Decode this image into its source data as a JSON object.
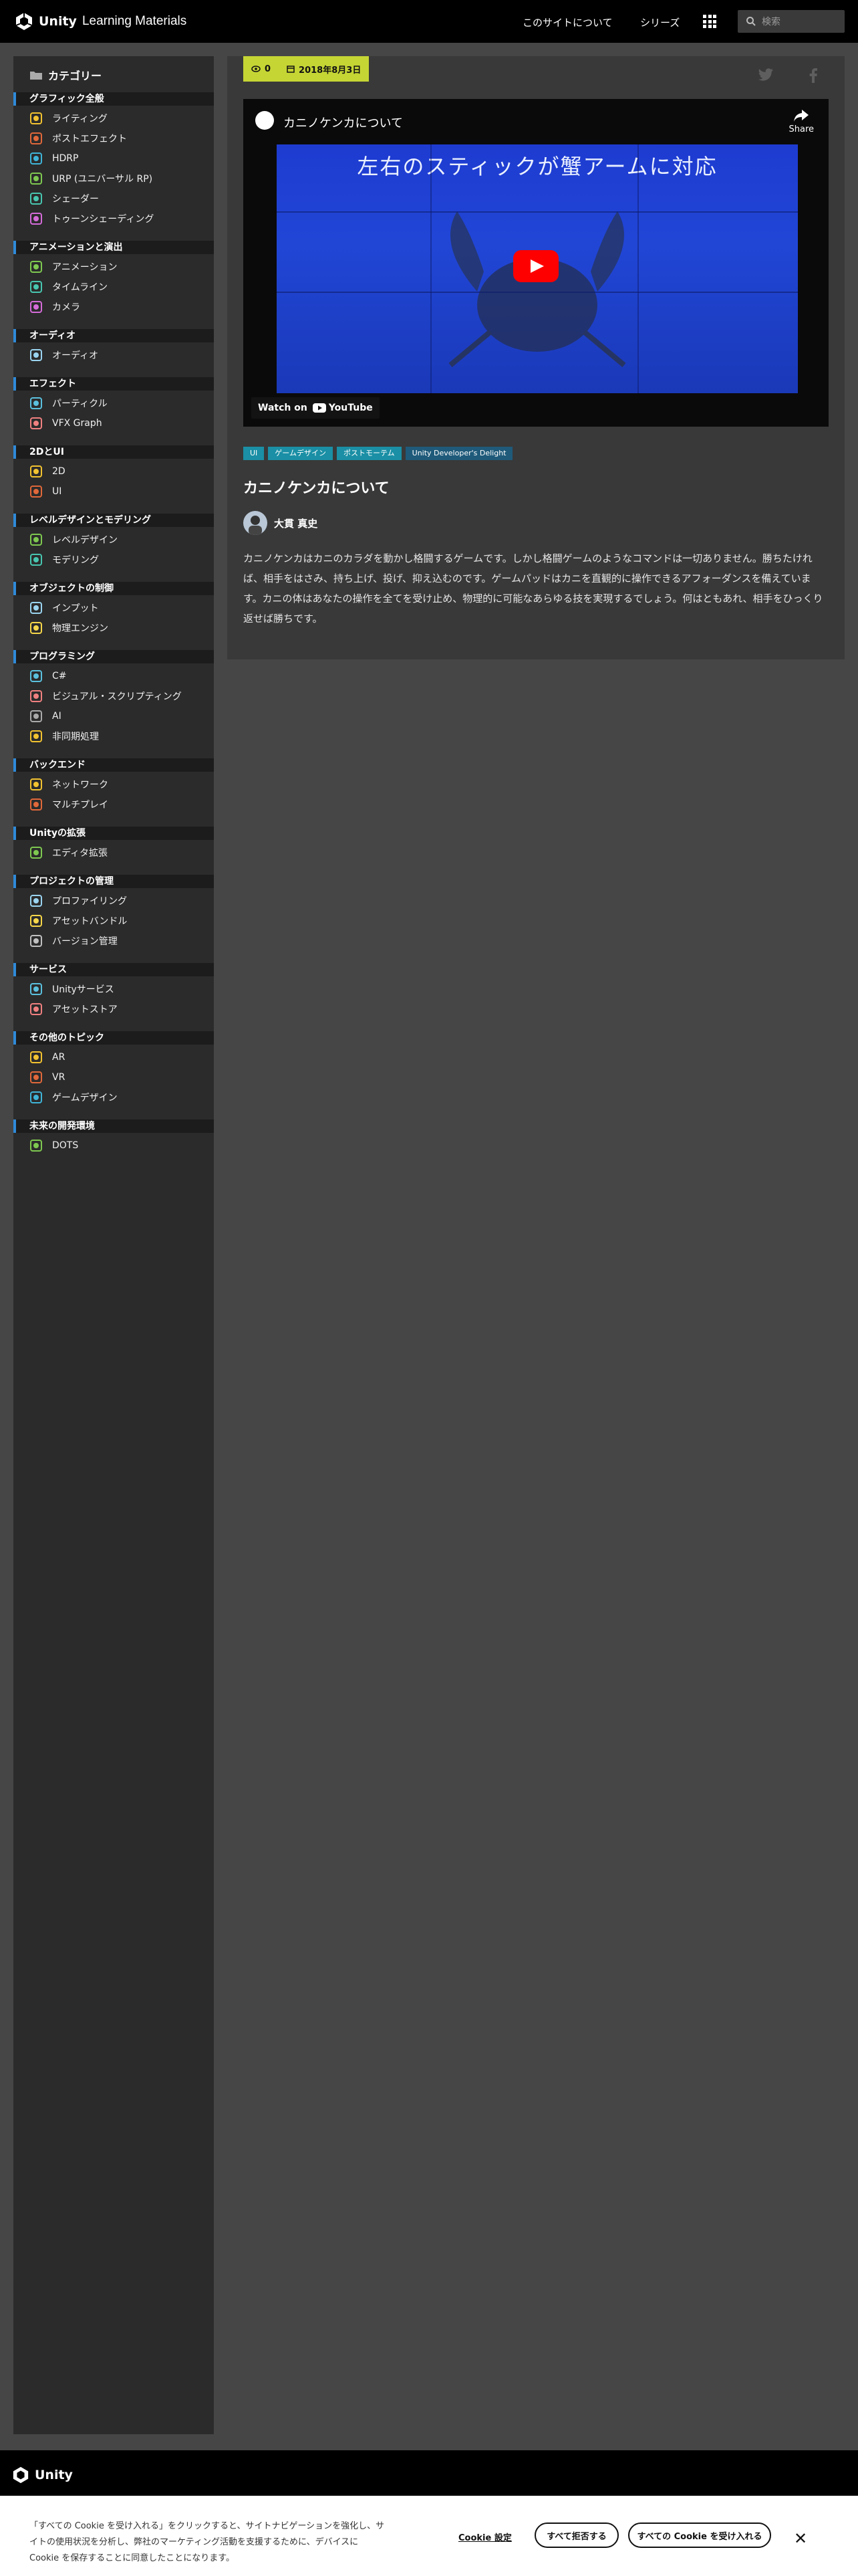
{
  "header": {
    "brand": "Unity",
    "subtitle": "Learning Materials",
    "nav": [
      "このサイトについて",
      "シリーズ"
    ],
    "search_placeholder": "検索"
  },
  "sidebar": {
    "heading": "カテゴリー",
    "categories": [
      {
        "title": "グラフィック全般",
        "items": [
          "ライティング",
          "ポストエフェクト",
          "HDRP",
          "URP (ユニバーサル RP)",
          "シェーダー",
          "トゥーンシェーディング"
        ]
      },
      {
        "title": "アニメーションと演出",
        "items": [
          "アニメーション",
          "タイムライン",
          "カメラ"
        ]
      },
      {
        "title": "オーディオ",
        "items": [
          "オーディオ"
        ]
      },
      {
        "title": "エフェクト",
        "items": [
          "パーティクル",
          "VFX Graph"
        ]
      },
      {
        "title": "2DとUI",
        "items": [
          "2D",
          "UI"
        ]
      },
      {
        "title": "レベルデザインとモデリング",
        "items": [
          "レベルデザイン",
          "モデリング"
        ]
      },
      {
        "title": "オブジェクトの制御",
        "items": [
          "インプット",
          "物理エンジン"
        ]
      },
      {
        "title": "プログラミング",
        "items": [
          "C#",
          "ビジュアル・スクリプティング",
          "AI",
          "非同期処理"
        ]
      },
      {
        "title": "バックエンド",
        "items": [
          "ネットワーク",
          "マルチプレイ"
        ]
      },
      {
        "title": "Unityの拡張",
        "items": [
          "エディタ拡張"
        ]
      },
      {
        "title": "プロジェクトの管理",
        "items": [
          "プロファイリング",
          "アセットバンドル",
          "バージョン管理"
        ]
      },
      {
        "title": "サービス",
        "items": [
          "Unityサービス",
          "アセットストア"
        ]
      },
      {
        "title": "その他のトピック",
        "items": [
          "AR",
          "VR",
          "ゲームデザイン"
        ]
      },
      {
        "title": "未来の開発環境",
        "items": [
          "DOTS"
        ]
      }
    ]
  },
  "post": {
    "views": "0",
    "date": "2018年8月3日",
    "video": {
      "title": "カニノケンカについて",
      "caption": "左右のスティックが蟹アームに対応",
      "share_label": "Share",
      "watch_on": "Watch on",
      "platform": "YouTube"
    },
    "tags": [
      "UI",
      "ゲームデザイン",
      "ポストモーテム",
      "Unity Developer's Delight"
    ],
    "title": "カニノケンカについて",
    "author": "大貫 真史",
    "body": "カニノケンカはカニのカラダを動かし格闘するゲームです。しかし格闘ゲームのようなコマンドは一切ありません。勝ちたければ、相手をはさみ、持ち上げ、投げ、抑え込むのです。ゲームパッドはカニを直観的に操作できるアフォーダンスを備えています。カニの体はあなたの操作を全てを受け止め、物理的に可能なあらゆる技を実現するでしょう。何はともあれ、相手をひっくり返せば勝ちです。"
  },
  "footer": {
    "brand": "Unity"
  },
  "cookie": {
    "text": "「すべての Cookie を受け入れる」をクリックすると、サイトナビゲーションを強化し、サイトの使用状況を分析し、弊社のマーケティング活動を支援するために、デバイスに Cookie を保存することに同意したことになります。",
    "settings": "Cookie 設定",
    "reject": "すべて拒否する",
    "accept": "すべての Cookie を受け入れる"
  }
}
